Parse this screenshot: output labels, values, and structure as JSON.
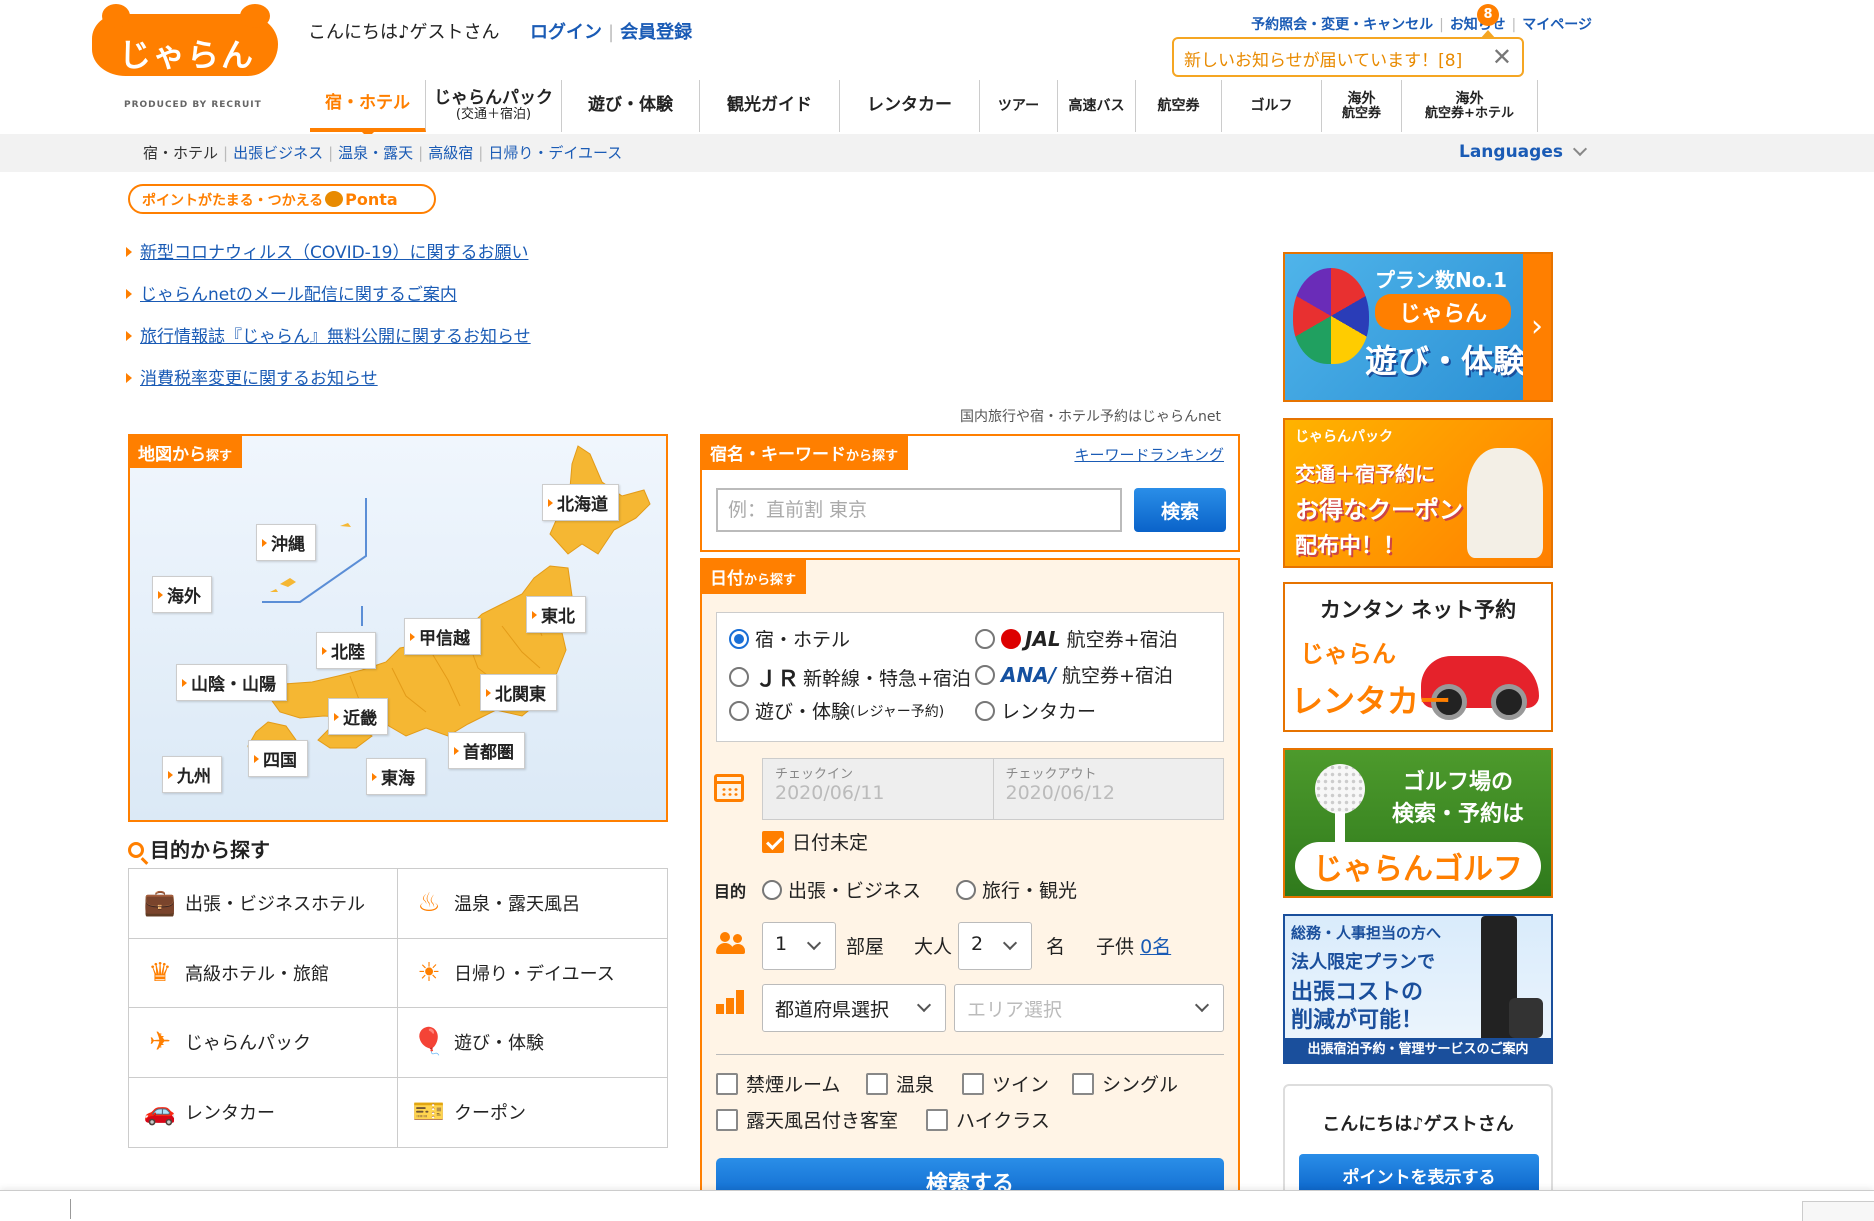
{
  "logo": {
    "text": "じゃらん",
    "produced_by": "PRODUCED BY RECRUIT"
  },
  "header": {
    "greeting": "こんにちは♪ゲストさん",
    "login": "ログイン",
    "register": "会員登録",
    "top_links": [
      "予約照会・変更・キャンセル",
      "お知らせ",
      "マイページ"
    ],
    "notice_count": "8",
    "notice_popup": "新しいお知らせが届いています！[8]"
  },
  "main_nav": [
    {
      "label": "宿・ホテル",
      "sub": ""
    },
    {
      "label": "じゃらんパック",
      "sub": "(交通＋宿泊)"
    },
    {
      "label": "遊び・体験",
      "sub": ""
    },
    {
      "label": "観光ガイド",
      "sub": ""
    },
    {
      "label": "レンタカー",
      "sub": ""
    },
    {
      "label": "ツアー",
      "sub": ""
    },
    {
      "label": "高速バス",
      "sub": ""
    },
    {
      "label": "航空券",
      "sub": ""
    },
    {
      "label": "ゴルフ",
      "sub": ""
    },
    {
      "label": "海外",
      "sub": "航空券"
    },
    {
      "label": "海外",
      "sub": "航空券+ホテル"
    }
  ],
  "sub_nav": {
    "current": "宿・ホテル",
    "links": [
      "出張ビジネス",
      "温泉・露天",
      "高級宿",
      "日帰り・デイユース"
    ],
    "languages": "Languages"
  },
  "ponta": {
    "text": "ポイントがたまる・つかえる",
    "brand": "Ponta"
  },
  "notices": [
    "新型コロナウィルス（COVID-19）に関するお願い",
    "じゃらんnetのメール配信に関するご案内",
    "旅行情報誌『じゃらん』無料公開に関するお知らせ",
    "消費税率変更に関するお知らせ"
  ],
  "tagline": "国内旅行や宿・ホテル予約はじゃらんnet",
  "map": {
    "tab_main": "地図から",
    "tab_sub": "探す",
    "regions": [
      "北海道",
      "沖縄",
      "海外",
      "東北",
      "甲信越",
      "北陸",
      "山陰・山陽",
      "北関東",
      "近畿",
      "首都圏",
      "四国",
      "九州",
      "東海"
    ]
  },
  "purpose": {
    "title": "目的から探す",
    "items": [
      {
        "label": "出張・ビジネスホテル",
        "icon": "briefcase-icon"
      },
      {
        "label": "温泉・露天風呂",
        "icon": "hot-spring-icon"
      },
      {
        "label": "高級ホテル・旅館",
        "icon": "luxury-icon"
      },
      {
        "label": "日帰り・デイユース",
        "icon": "sun-icon"
      },
      {
        "label": "じゃらんパック",
        "icon": "plane-hotel-icon"
      },
      {
        "label": "遊び・体験",
        "icon": "balloon-icon"
      },
      {
        "label": "レンタカー",
        "icon": "car-icon"
      },
      {
        "label": "クーポン",
        "icon": "coupon-icon"
      }
    ]
  },
  "keyword": {
    "tab_main": "宿名・キーワード",
    "tab_sub": "から探す",
    "ranking": "キーワードランキング",
    "placeholder": "例：直前割 東京",
    "button": "検索"
  },
  "date_search": {
    "tab_main": "日付",
    "tab_sub": "から探す",
    "types": {
      "hotel": "宿・ホテル",
      "jal_brand": "JAL",
      "jal": "航空券+宿泊",
      "jr_brand": "ＪＲ",
      "jr": "新幹線・特急+宿泊",
      "ana_brand": "ANA",
      "ana": "航空券+宿泊",
      "leisure": "遊び・体験",
      "leisure_sub": "(レジャー予約)",
      "rentacar": "レンタカー"
    },
    "checkin_label": "チェックイン",
    "checkin": "2020/06/11",
    "checkout_label": "チェックアウト",
    "checkout": "2020/06/12",
    "undecided": "日付未定",
    "purpose_label": "目的",
    "purpose_business": "出張・ビジネス",
    "purpose_travel": "旅行・観光",
    "rooms": "1",
    "rooms_unit": "部屋",
    "adult_label": "大人",
    "adults": "2",
    "adult_unit": "名",
    "child_label": "子供",
    "children": "0名",
    "prefecture": "都道府県選択",
    "area": "エリア選択",
    "options": [
      "禁煙ルーム",
      "温泉",
      "ツイン",
      "シングル",
      "露天風呂付き客室",
      "ハイクラス"
    ],
    "search_button": "検索する"
  },
  "banners": {
    "activity": {
      "line1": "プラン数No.1",
      "line2": "じゃらん",
      "line3": "遊び・体験"
    },
    "coupon": {
      "line1": "じゃらんパック",
      "line2": "交通＋宿予約に",
      "line3": "お得なクーポン",
      "line4": "配布中！！"
    },
    "rentacar": {
      "line1": "カンタン ネット予約",
      "line2": "じゃらん",
      "line3": "レンタカー"
    },
    "golf": {
      "line1": "ゴルフ場の",
      "line2": "検索・予約は",
      "line3": "じゃらんゴルフ"
    },
    "business": {
      "line1": "総務・人事担当の方へ",
      "line2": "法人限定プランで",
      "line3": "出張コストの",
      "line4": "削減が可能！",
      "strip": "出張宿泊予約・管理サービスのご案内"
    }
  },
  "guest_box": {
    "title": "こんにちは♪ゲストさん",
    "button": "ポイントを表示する"
  }
}
